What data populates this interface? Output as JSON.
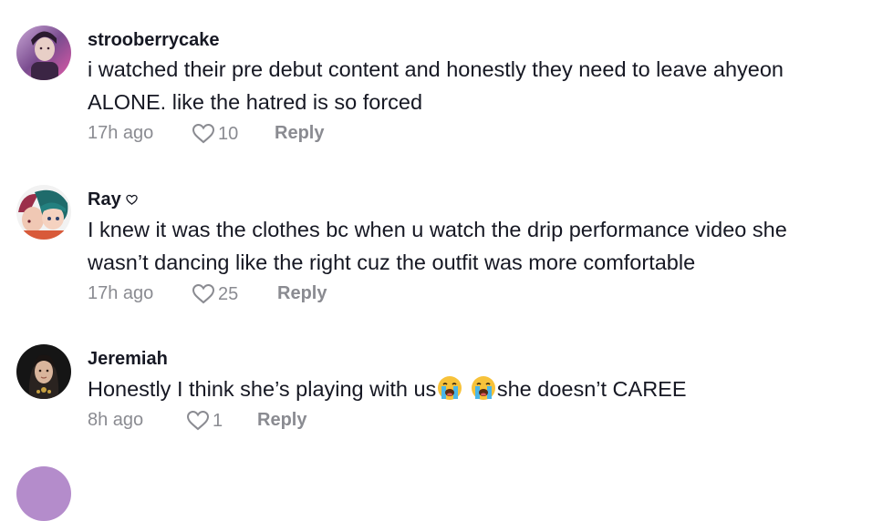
{
  "comments": [
    {
      "username": "strooberrycake",
      "text_line1": "i watched their pre debut content and honestly they need to leave ahyeon",
      "text_line2": "ALONE. like the hatred is so forced",
      "time": "17h ago",
      "likes": "10",
      "reply_label": "Reply",
      "avatar_icon": "avatar-pink-purple"
    },
    {
      "username": "Ray",
      "badge_icon": "small-heart-icon",
      "text_line1": "I knew it was the clothes bc when u watch the drip performance video she",
      "text_line2": "wasn’t dancing like the right cuz the outfit was more comfortable",
      "time": "17h ago",
      "likes": "25",
      "reply_label": "Reply",
      "avatar_icon": "avatar-anime-duo"
    },
    {
      "username": "Jeremiah",
      "text_before_emoji": "Honestly I think she’s playing with us",
      "emojis": [
        "loudly-crying-face",
        "loudly-crying-face"
      ],
      "text_after_emoji": "she doesn’t CAREE",
      "time": "8h ago",
      "likes": "1",
      "reply_label": "Reply",
      "avatar_icon": "avatar-dark-portrait"
    }
  ],
  "colors": {
    "primary_text": "#161823",
    "secondary_text": "#8a8b91"
  }
}
